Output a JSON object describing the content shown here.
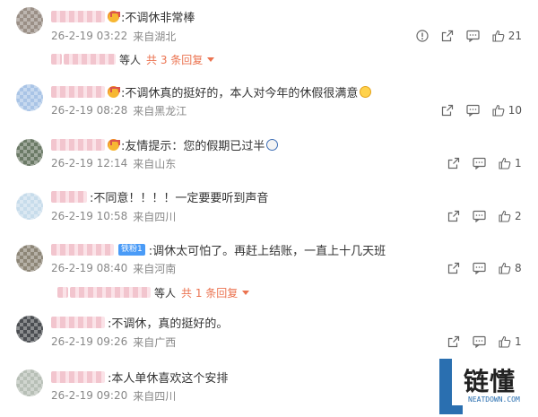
{
  "comments": [
    {
      "text": ":不调休非常棒",
      "time": "26-2-19 03:22",
      "location": "来自湖北",
      "like_count": "21",
      "avatar_color": "#9a8f86",
      "replies": {
        "who": "等人",
        "link": "共 3 条回复"
      }
    },
    {
      "text": ":不调休真的挺好的，本人对今年的休假很满意",
      "time": "26-2-19 08:28",
      "location": "来自黑龙江",
      "like_count": "10",
      "avatar_color": "#a9c4e6"
    },
    {
      "text": ":友情提示：您的假期已过半",
      "time": "26-2-19 12:14",
      "location": "来自山东",
      "like_count": "1",
      "avatar_color": "#6b7a66"
    },
    {
      "text": ":不同意！！！！一定要要听到声音",
      "time": "26-2-19 10:58",
      "location": "来自四川",
      "like_count": "2",
      "avatar_color": "#c7dceb"
    },
    {
      "text": ":调休太可怕了。再赶上结账，一直上十几天班",
      "time": "26-2-19 08:40",
      "location": "来自河南",
      "like_count": "8",
      "avatar_color": "#8d8677",
      "badge": "铁粉1",
      "replies": {
        "who": "等人",
        "link": "共 1 条回复"
      }
    },
    {
      "text": ":不调休，真的挺好的。",
      "time": "26-2-19 09:26",
      "location": "来自广西",
      "like_count": "1",
      "avatar_color": "#4b4e52"
    },
    {
      "text": ":本人单休喜欢这个安排",
      "time": "26-2-19 09:20",
      "location": "来自四川",
      "like_count": "",
      "avatar_color": "#b7bfb6"
    }
  ],
  "watermark": {
    "brand": "链懂",
    "domain": "NEATDOWN.COM",
    "letter": "L",
    "color": "#2a6fb0"
  },
  "icons": {
    "report": "alert-circle-icon",
    "share": "share-icon",
    "comment": "comment-icon",
    "like": "thumbs-up-icon"
  }
}
